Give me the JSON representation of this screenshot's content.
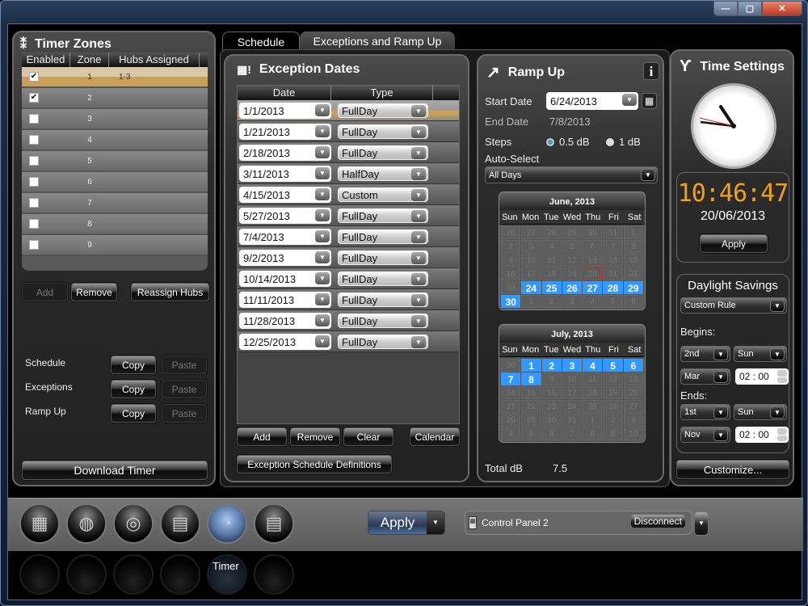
{
  "window": {
    "minimize": "—",
    "maximize": "▢",
    "close": "✕"
  },
  "timer_zones": {
    "title": "Timer Zones",
    "columns": [
      "Enabled",
      "Zone",
      "Hubs Assigned"
    ],
    "rows": [
      {
        "enabled": true,
        "zone": "1",
        "hubs": "1-3",
        "selected": true
      },
      {
        "enabled": true,
        "zone": "2",
        "hubs": ""
      },
      {
        "enabled": false,
        "zone": "3",
        "hubs": ""
      },
      {
        "enabled": false,
        "zone": "4",
        "hubs": ""
      },
      {
        "enabled": false,
        "zone": "5",
        "hubs": ""
      },
      {
        "enabled": false,
        "zone": "6",
        "hubs": ""
      },
      {
        "enabled": false,
        "zone": "7",
        "hubs": ""
      },
      {
        "enabled": false,
        "zone": "8",
        "hubs": ""
      },
      {
        "enabled": false,
        "zone": "9",
        "hubs": ""
      }
    ],
    "add": "Add",
    "remove": "Remove",
    "reassign": "Reassign Hubs",
    "copy_rows": [
      {
        "label": "Schedule",
        "copy": "Copy",
        "paste": "Paste"
      },
      {
        "label": "Exceptions",
        "copy": "Copy",
        "paste": "Paste"
      },
      {
        "label": "Ramp Up",
        "copy": "Copy",
        "paste": "Paste"
      }
    ],
    "download": "Download Timer"
  },
  "tabs": [
    {
      "label": "Schedule"
    },
    {
      "label": "Exceptions and Ramp Up",
      "active": true
    }
  ],
  "exceptions": {
    "title": "Exception Dates",
    "columns": [
      "Date",
      "Type"
    ],
    "rows": [
      {
        "date": "1/1/2013",
        "type": "FullDay"
      },
      {
        "date": "1/21/2013",
        "type": "FullDay"
      },
      {
        "date": "2/18/2013",
        "type": "FullDay"
      },
      {
        "date": "3/11/2013",
        "type": "HalfDay"
      },
      {
        "date": "4/15/2013",
        "type": "Custom"
      },
      {
        "date": "5/27/2013",
        "type": "FullDay"
      },
      {
        "date": "7/4/2013",
        "type": "FullDay"
      },
      {
        "date": "9/2/2013",
        "type": "FullDay"
      },
      {
        "date": "10/14/2013",
        "type": "FullDay"
      },
      {
        "date": "11/11/2013",
        "type": "FullDay"
      },
      {
        "date": "11/28/2013",
        "type": "FullDay"
      },
      {
        "date": "12/25/2013",
        "type": "FullDay"
      }
    ],
    "add": "Add",
    "remove": "Remove",
    "clear": "Clear",
    "calendar": "Calendar",
    "definitions": "Exception Schedule Definitions"
  },
  "ramp_up": {
    "title": "Ramp Up",
    "info": "i",
    "start_label": "Start Date",
    "start_value": "6/24/2013",
    "end_label": "End Date",
    "end_value": "7/8/2013",
    "steps_label": "Steps",
    "step_options": [
      "0.5 dB",
      "1 dB"
    ],
    "step_selected": "0.5 dB",
    "auto_label": "Auto-Select",
    "auto_value": "All Days",
    "total_label": "Total dB",
    "total_value": "7.5",
    "dow": [
      "Sun",
      "Mon",
      "Tue",
      "Wed",
      "Thu",
      "Fri",
      "Sat"
    ],
    "june": {
      "title": "June, 2013",
      "days": [
        "26",
        "27",
        "28",
        "29",
        "30",
        "31",
        "1",
        "2",
        "3",
        "4",
        "5",
        "6",
        "7",
        "8",
        "9",
        "10",
        "11",
        "12",
        "13",
        "14",
        "15",
        "16",
        "17",
        "18",
        "19",
        "20",
        "21",
        "22",
        "23",
        "24",
        "25",
        "26",
        "27",
        "28",
        "29",
        "30",
        "1",
        "2",
        "3",
        "4",
        "5",
        "6"
      ],
      "selected": [
        29,
        30,
        31,
        32,
        33,
        34,
        35
      ],
      "today": 25
    },
    "july": {
      "title": "July, 2013",
      "days": [
        "30",
        "1",
        "2",
        "3",
        "4",
        "5",
        "6",
        "7",
        "8",
        "9",
        "10",
        "11",
        "12",
        "13",
        "14",
        "15",
        "16",
        "17",
        "18",
        "19",
        "20",
        "21",
        "22",
        "23",
        "24",
        "25",
        "26",
        "27",
        "28",
        "29",
        "30",
        "31",
        "1",
        "2",
        "3",
        "4",
        "5",
        "6",
        "7",
        "8",
        "9",
        "10"
      ],
      "selected": [
        1,
        2,
        3,
        4,
        5,
        6,
        7,
        8
      ]
    }
  },
  "time_settings": {
    "title": "Time Settings",
    "time": "10:46:47",
    "date": "20/06/2013",
    "apply": "Apply"
  },
  "daylight": {
    "title": "Daylight Savings",
    "rule": "Custom Rule",
    "begins_label": "Begins:",
    "begins_week": "2nd",
    "begins_day": "Sun",
    "begins_month": "Mar",
    "begins_time": "02 : 00",
    "ends_label": "Ends:",
    "ends_week": "1st",
    "ends_day": "Sun",
    "ends_month": "Nov",
    "ends_time": "02 : 00",
    "customize": "Customize..."
  },
  "bottom": {
    "active_label": "Timer",
    "apply": "Apply",
    "device": "Control Panel 2",
    "disconnect": "Disconnect"
  }
}
